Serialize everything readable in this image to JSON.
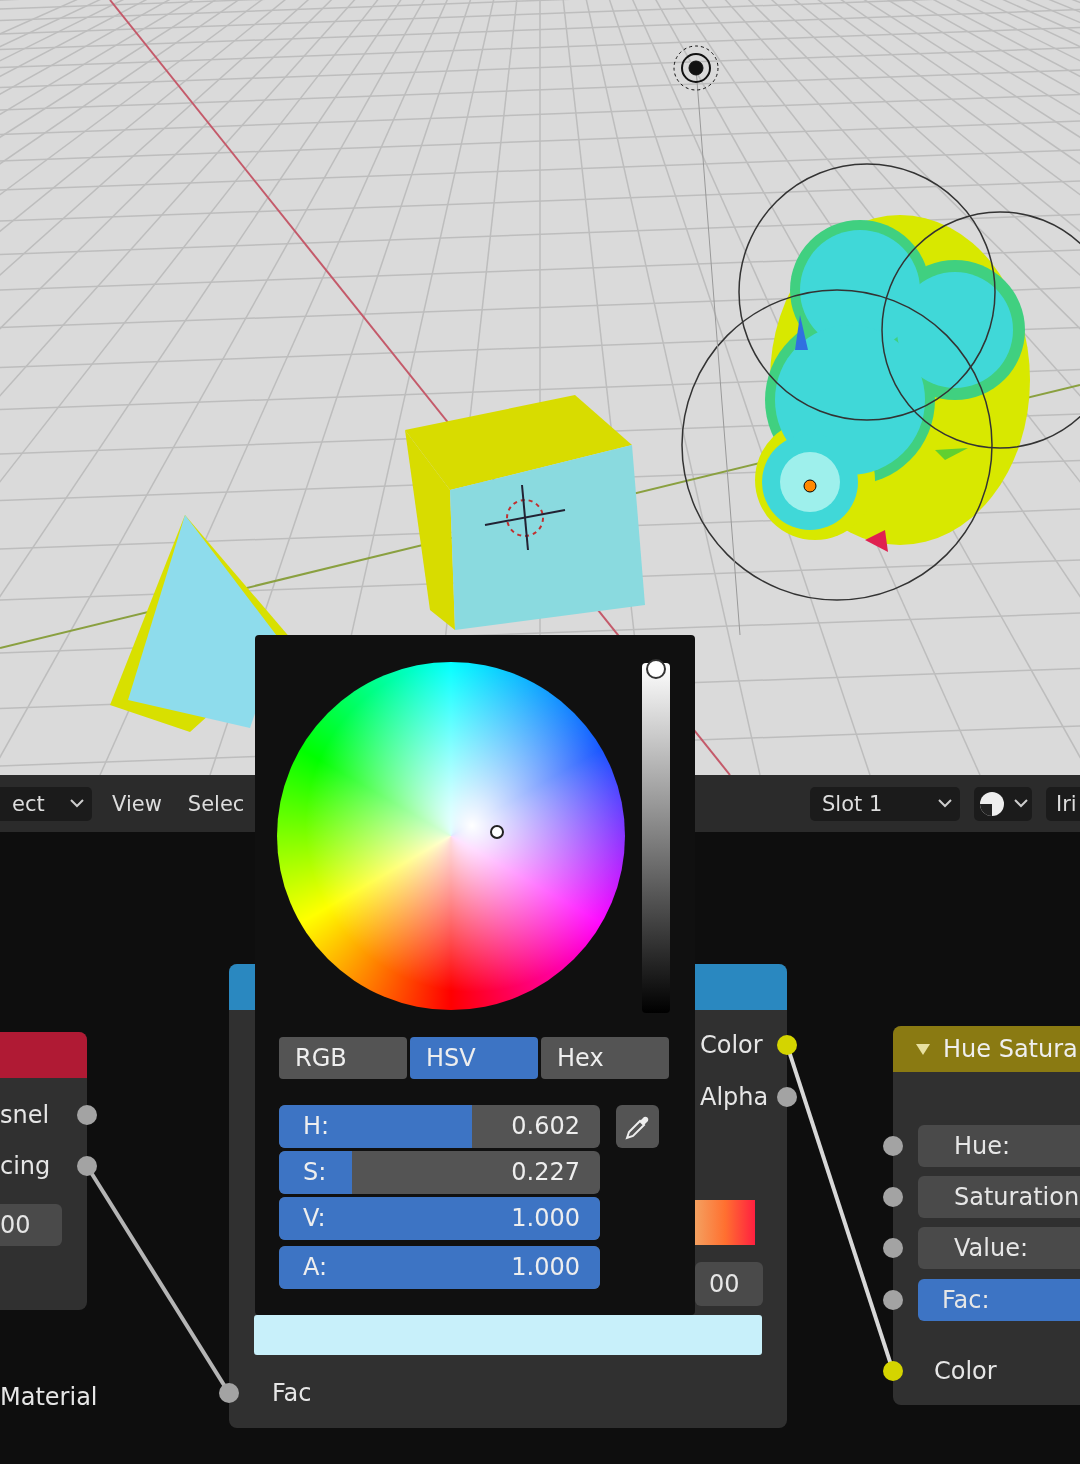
{
  "header": {
    "mode_dropdown": "ect",
    "menus": [
      "View",
      "Selec"
    ],
    "slot_dropdown": "Slot 1",
    "cut_label": "Iri"
  },
  "left_node": {
    "outputs": [
      "snel",
      "cing"
    ],
    "field": "00"
  },
  "material_label": "Material",
  "center_node": {
    "outputs": [
      {
        "label": "Color",
        "color": "#d4d400"
      },
      {
        "label": "Alpha",
        "color": "#a3a3a3"
      }
    ],
    "field": "00",
    "input": "Fac"
  },
  "right_node": {
    "title": "Hue Satura",
    "expanded": true,
    "inputs": [
      {
        "kind": "field",
        "label": "Hue:",
        "selected": false,
        "color": "#a3a3a3"
      },
      {
        "kind": "field",
        "label": "Saturation",
        "selected": false,
        "color": "#a3a3a3"
      },
      {
        "kind": "field",
        "label": "Value:",
        "selected": false,
        "color": "#a3a3a3"
      },
      {
        "kind": "field",
        "label": "Fac:",
        "selected": true,
        "color": "#a3a3a3"
      },
      {
        "kind": "socket",
        "label": "Color",
        "color": "#d4d400"
      }
    ]
  },
  "color_picker": {
    "value_slider": {
      "level": 1
    },
    "tabs": [
      {
        "label": "RGB",
        "selected": false
      },
      {
        "label": "HSV",
        "selected": true
      },
      {
        "label": "Hex",
        "selected": false
      }
    ],
    "sliders": [
      {
        "label": "H:",
        "value": "0.602",
        "level": 0.602
      },
      {
        "label": "S:",
        "value": "0.227",
        "level": 0.227
      },
      {
        "label": "V:",
        "value": "1.000",
        "level": 1
      },
      {
        "label": "A:",
        "value": "1.000",
        "level": 1
      }
    ]
  }
}
